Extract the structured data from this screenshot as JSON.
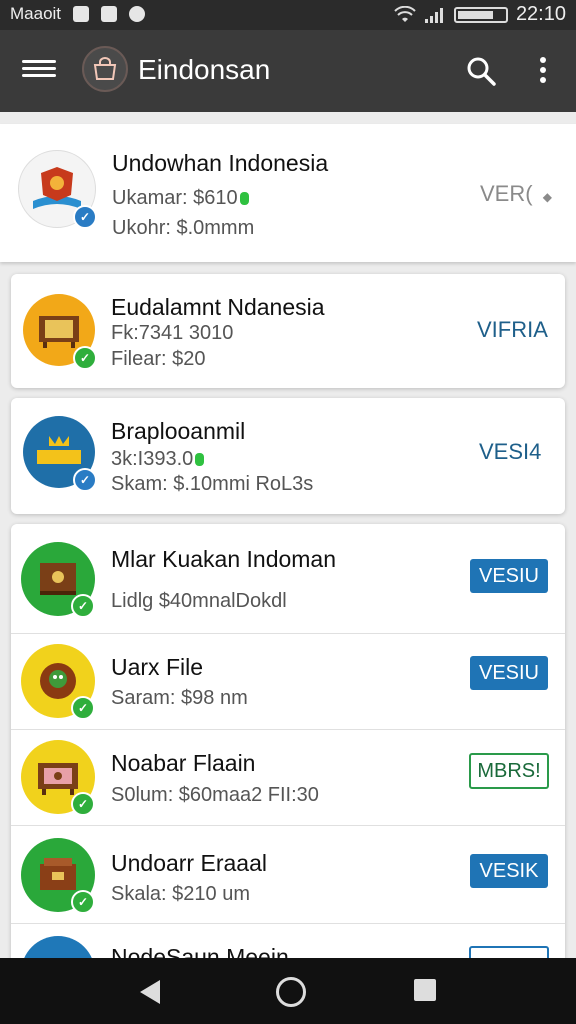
{
  "status_bar": {
    "carrier": "Maaoit",
    "time": "22:10"
  },
  "toolbar": {
    "title": "Eindonsan"
  },
  "featured": {
    "title": "Undowhan Indonesia",
    "line1": "Ukamar: $610",
    "line2": "Ukohr: $.0mmm",
    "action": "VER(",
    "badge": "blue"
  },
  "cards": [
    {
      "title": "Eudalamnt Ndanesia",
      "line1": "Fk:7341 3010",
      "line2": "Filear: $20",
      "action": "VIFRIA",
      "action_style": "text"
    },
    {
      "title": "Braplooanmil",
      "line1": "3k:I393.0",
      "line2": "Skam: $.10mmi RoL3s",
      "action": "VESI4",
      "action_style": "text"
    }
  ],
  "list": [
    {
      "title": "Mlar Kuakan Indoman",
      "line1": "Lidlg $40mnalDokdl",
      "action": "VESIU",
      "action_style": "filled"
    },
    {
      "title": "Uarx File",
      "line1": "Saram: $98 nm",
      "action": "VESIU",
      "action_style": "filled"
    },
    {
      "title": "Noabar Flaain",
      "line1": "S0lum: $60maa2 FII:30",
      "action": "MBRS!",
      "action_style": "outline"
    },
    {
      "title": "Undoarr Eraaal",
      "line1": "Skala: $210 um",
      "action": "VESIK",
      "action_style": "filled"
    },
    {
      "title": "NodeSaun Meein",
      "line1": "",
      "action": "",
      "action_style": "outline"
    }
  ],
  "colors": {
    "toolbar_bg": "#3a3a3a",
    "status_bg": "#2b2b2b",
    "accent_blue": "#1f74b5",
    "accent_green": "#2fae3c",
    "nav_bg": "#111111"
  }
}
